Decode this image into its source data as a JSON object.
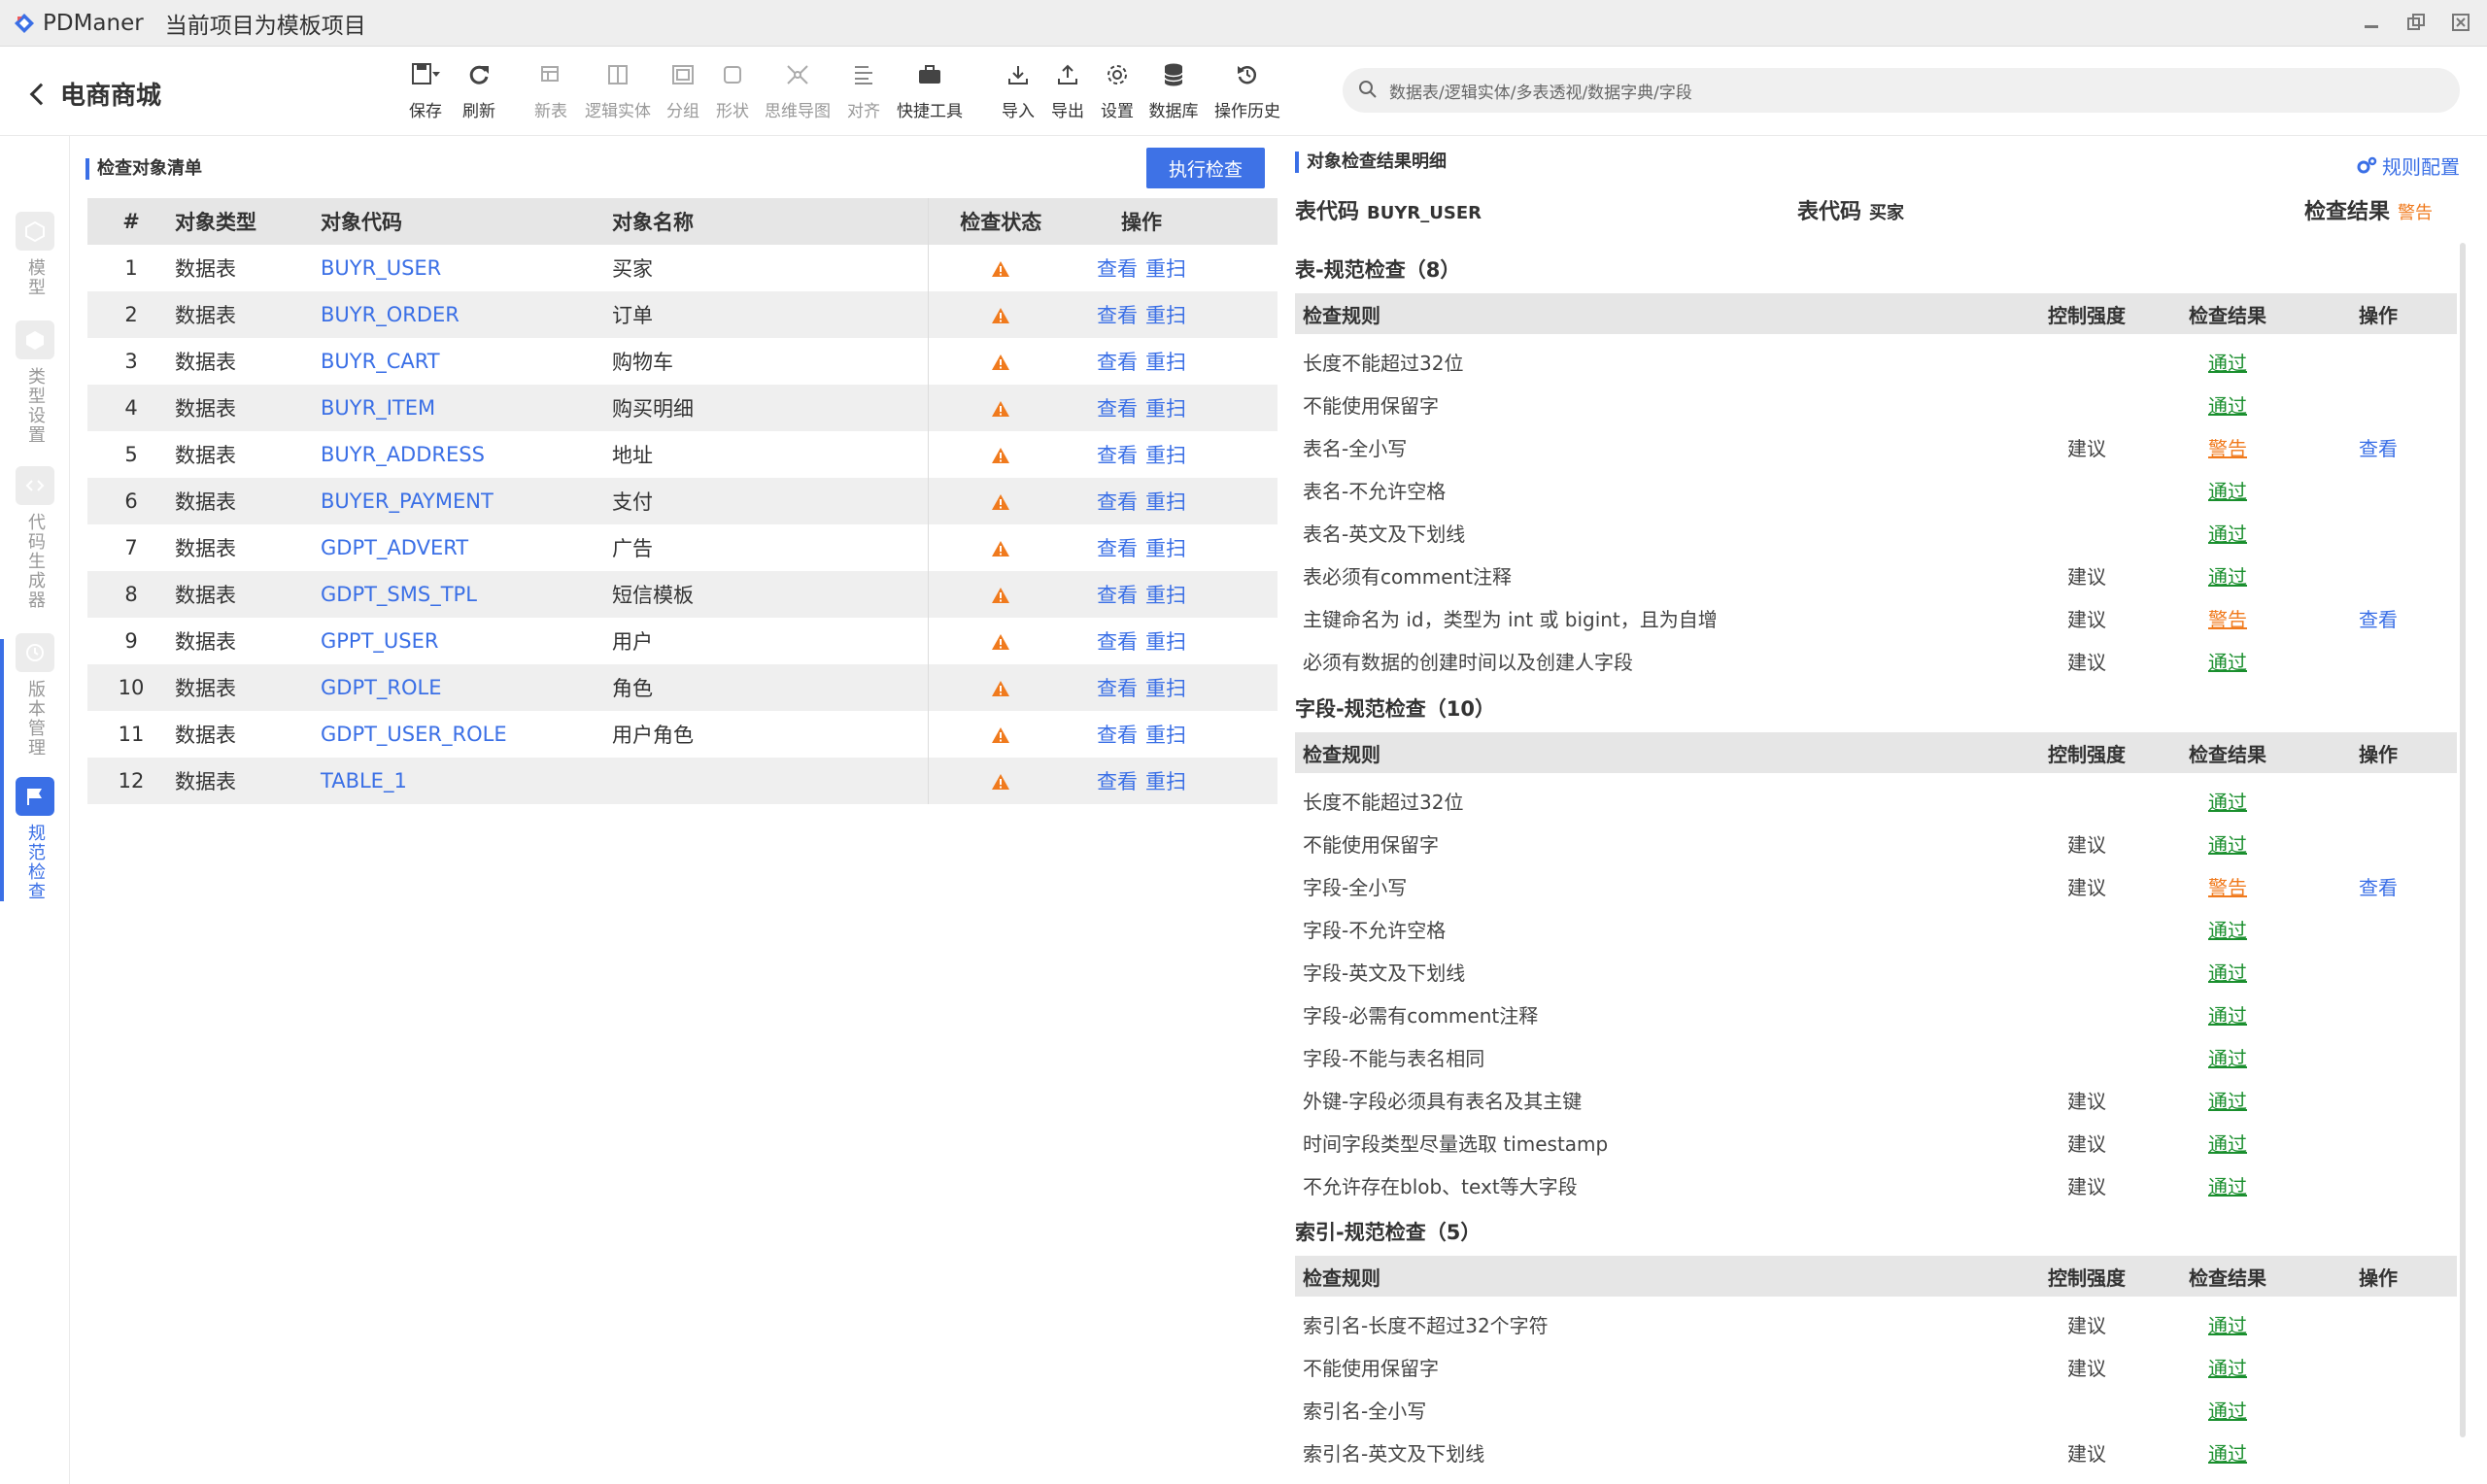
{
  "app": {
    "name": "PDManer",
    "project_status": "当前项目为模板项目",
    "project_title": "电商商城"
  },
  "toolbar": {
    "save": "保存",
    "refresh": "刷新",
    "new_table": "新表",
    "logic_entity": "逻辑实体",
    "group": "分组",
    "shape": "形状",
    "mind_map": "思维导图",
    "align": "对齐",
    "quick_tools": "快捷工具",
    "import": "导入",
    "export": "导出",
    "settings": "设置",
    "database": "数据库",
    "history": "操作历史"
  },
  "search": {
    "placeholder": "数据表/逻辑实体/多表透视/数据字典/字段"
  },
  "rail": {
    "model": "模型",
    "type_settings": "类型设置",
    "code_generator": "代码生成器",
    "version": "版本管理",
    "spec_check": "规范检查"
  },
  "left": {
    "title": "检查对象清单",
    "run_button": "执行检查",
    "headers": {
      "num": "#",
      "type": "对象类型",
      "code": "对象代码",
      "name": "对象名称",
      "status": "检查状态",
      "op": "操作"
    },
    "op_view": "查看",
    "op_rescan": "重扫",
    "rows": [
      {
        "num": "1",
        "type": "数据表",
        "code": "BUYR_USER",
        "name": "买家"
      },
      {
        "num": "2",
        "type": "数据表",
        "code": "BUYR_ORDER",
        "name": "订单"
      },
      {
        "num": "3",
        "type": "数据表",
        "code": "BUYR_CART",
        "name": "购物车"
      },
      {
        "num": "4",
        "type": "数据表",
        "code": "BUYR_ITEM",
        "name": "购买明细"
      },
      {
        "num": "5",
        "type": "数据表",
        "code": "BUYR_ADDRESS",
        "name": "地址"
      },
      {
        "num": "6",
        "type": "数据表",
        "code": "BUYER_PAYMENT",
        "name": "支付"
      },
      {
        "num": "7",
        "type": "数据表",
        "code": "GDPT_ADVERT",
        "name": "广告"
      },
      {
        "num": "8",
        "type": "数据表",
        "code": "GDPT_SMS_TPL",
        "name": "短信模板"
      },
      {
        "num": "9",
        "type": "数据表",
        "code": "GPPT_USER",
        "name": "用户"
      },
      {
        "num": "10",
        "type": "数据表",
        "code": "GDPT_ROLE",
        "name": "角色"
      },
      {
        "num": "11",
        "type": "数据表",
        "code": "GDPT_USER_ROLE",
        "name": "用户角色"
      },
      {
        "num": "12",
        "type": "数据表",
        "code": "TABLE_1",
        "name": ""
      }
    ]
  },
  "right": {
    "title": "对象检查结果明细",
    "rule_config": "规则配置",
    "summary": {
      "code_label": "表代码",
      "code_value": "BUYR_USER",
      "name_label": "表代码",
      "name_value": "买家",
      "result_label": "检查结果",
      "result_value": "警告"
    },
    "headers": {
      "rule": "检查规则",
      "strength": "控制强度",
      "result": "检查结果",
      "op": "操作"
    },
    "groups": [
      {
        "title": "表-规范检查（8）",
        "rows": [
          {
            "rule": "长度不能超过32位",
            "strength": "",
            "result": "通过",
            "op": ""
          },
          {
            "rule": "不能使用保留字",
            "strength": "",
            "result": "通过",
            "op": ""
          },
          {
            "rule": "表名-全小写",
            "strength": "建议",
            "result": "警告",
            "op": "查看"
          },
          {
            "rule": "表名-不允许空格",
            "strength": "",
            "result": "通过",
            "op": ""
          },
          {
            "rule": "表名-英文及下划线",
            "strength": "",
            "result": "通过",
            "op": ""
          },
          {
            "rule": "表必须有comment注释",
            "strength": "建议",
            "result": "通过",
            "op": ""
          },
          {
            "rule": "主键命名为 id，类型为 int 或 bigint，且为自增",
            "strength": "建议",
            "result": "警告",
            "op": "查看"
          },
          {
            "rule": "必须有数据的创建时间以及创建人字段",
            "strength": "建议",
            "result": "通过",
            "op": ""
          }
        ]
      },
      {
        "title": "字段-规范检查（10）",
        "rows": [
          {
            "rule": "长度不能超过32位",
            "strength": "",
            "result": "通过",
            "op": ""
          },
          {
            "rule": "不能使用保留字",
            "strength": "建议",
            "result": "通过",
            "op": ""
          },
          {
            "rule": "字段-全小写",
            "strength": "建议",
            "result": "警告",
            "op": "查看"
          },
          {
            "rule": "字段-不允许空格",
            "strength": "",
            "result": "通过",
            "op": ""
          },
          {
            "rule": "字段-英文及下划线",
            "strength": "",
            "result": "通过",
            "op": ""
          },
          {
            "rule": "字段-必需有comment注释",
            "strength": "",
            "result": "通过",
            "op": ""
          },
          {
            "rule": "字段-不能与表名相同",
            "strength": "",
            "result": "通过",
            "op": ""
          },
          {
            "rule": "外键-字段必须具有表名及其主键",
            "strength": "建议",
            "result": "通过",
            "op": ""
          },
          {
            "rule": "时间字段类型尽量选取 timestamp",
            "strength": "建议",
            "result": "通过",
            "op": ""
          },
          {
            "rule": "不允许存在blob、text等大字段",
            "strength": "建议",
            "result": "通过",
            "op": ""
          }
        ]
      },
      {
        "title": "索引-规范检查（5）",
        "rows": [
          {
            "rule": "索引名-长度不超过32个字符",
            "strength": "建议",
            "result": "通过",
            "op": ""
          },
          {
            "rule": "不能使用保留字",
            "strength": "建议",
            "result": "通过",
            "op": ""
          },
          {
            "rule": "索引名-全小写",
            "strength": "",
            "result": "通过",
            "op": ""
          },
          {
            "rule": "索引名-英文及下划线",
            "strength": "建议",
            "result": "通过",
            "op": ""
          }
        ]
      }
    ]
  },
  "colors": {
    "accent": "#3a6fe6",
    "pass": "#1a8f2e",
    "warn": "#f07a1d"
  }
}
